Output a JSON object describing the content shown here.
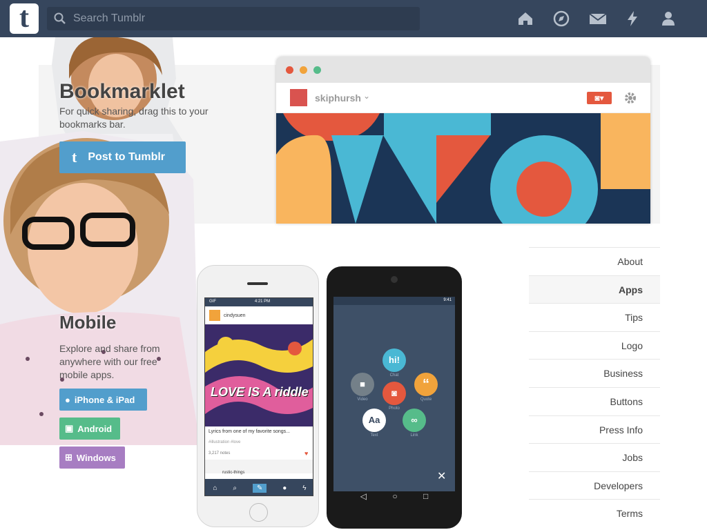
{
  "topbar": {
    "logo_letter": "t",
    "search_placeholder": "Search Tumblr",
    "icons": [
      "home-icon",
      "compass-icon",
      "mail-icon",
      "lightning-icon",
      "account-icon"
    ]
  },
  "bookmarklet": {
    "title": "Bookmarklet",
    "description": "For quick sharing, drag this to your bookmarks bar.",
    "button_label": "Post to Tumblr"
  },
  "browser_mock": {
    "username": "skiphursh"
  },
  "mobile": {
    "title": "Mobile",
    "description": "Explore and share from anywhere with our free mobile apps.",
    "buttons": [
      {
        "label": "iPhone & iPad",
        "color": "#529ecc"
      },
      {
        "label": "Android",
        "color": "#56bc8a"
      },
      {
        "label": "Windows",
        "color": "#a77dc2"
      }
    ]
  },
  "iphone": {
    "carrier": "GIF",
    "time": "4:21 PM",
    "post_user": "cindysuen",
    "art_text": "LOVE IS A riddle",
    "caption": "Lyrics from one of my favorite songs...",
    "tags": "#illustration  #love",
    "notes": "3,217 notes",
    "next_user": "rustic-things"
  },
  "android": {
    "time": "9:41",
    "bubbles": [
      {
        "icon": "hi!",
        "label": "Chat",
        "color": "#4ab8d4"
      },
      {
        "icon": "",
        "label": "Video",
        "color": "#748089"
      },
      {
        "icon": "",
        "label": "Photo",
        "color": "#e4583e"
      },
      {
        "icon": "“",
        "label": "Quote",
        "color": "#f1a33b"
      },
      {
        "icon": "Aa",
        "label": "Text",
        "color": "#ffffff"
      },
      {
        "icon": "",
        "label": "Link",
        "color": "#56bc8a"
      }
    ],
    "close_icon": "✕"
  },
  "sidenav": {
    "items": [
      {
        "label": "About",
        "active": false
      },
      {
        "label": "Apps",
        "active": true
      },
      {
        "label": "Tips",
        "active": false
      },
      {
        "label": "Logo",
        "active": false
      },
      {
        "label": "Business",
        "active": false
      },
      {
        "label": "Buttons",
        "active": false
      },
      {
        "label": "Press Info",
        "active": false
      },
      {
        "label": "Jobs",
        "active": false
      },
      {
        "label": "Developers",
        "active": false
      },
      {
        "label": "Terms",
        "active": false
      }
    ]
  }
}
